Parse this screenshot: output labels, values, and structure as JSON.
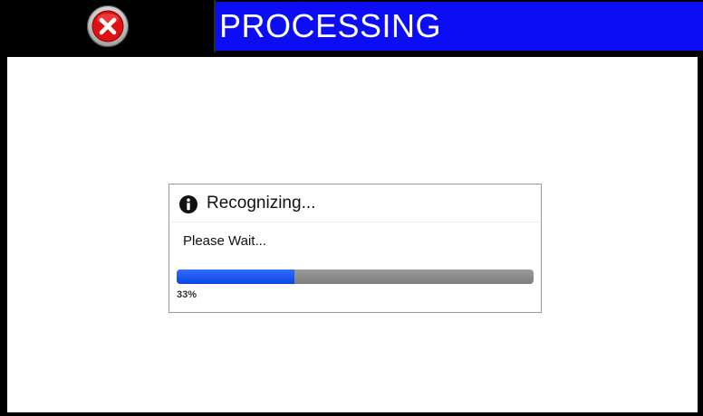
{
  "window": {
    "title": "PROCESSING",
    "close_icon": "close-icon",
    "title_bg_color": "#0d0df5",
    "close_color": "#dd1111"
  },
  "dialog": {
    "icon": "info-icon",
    "title": "Recognizing...",
    "message": "Please Wait...",
    "progress": {
      "fraction": 0.33,
      "label": "33%",
      "fill_color": "#1a55f0"
    }
  }
}
